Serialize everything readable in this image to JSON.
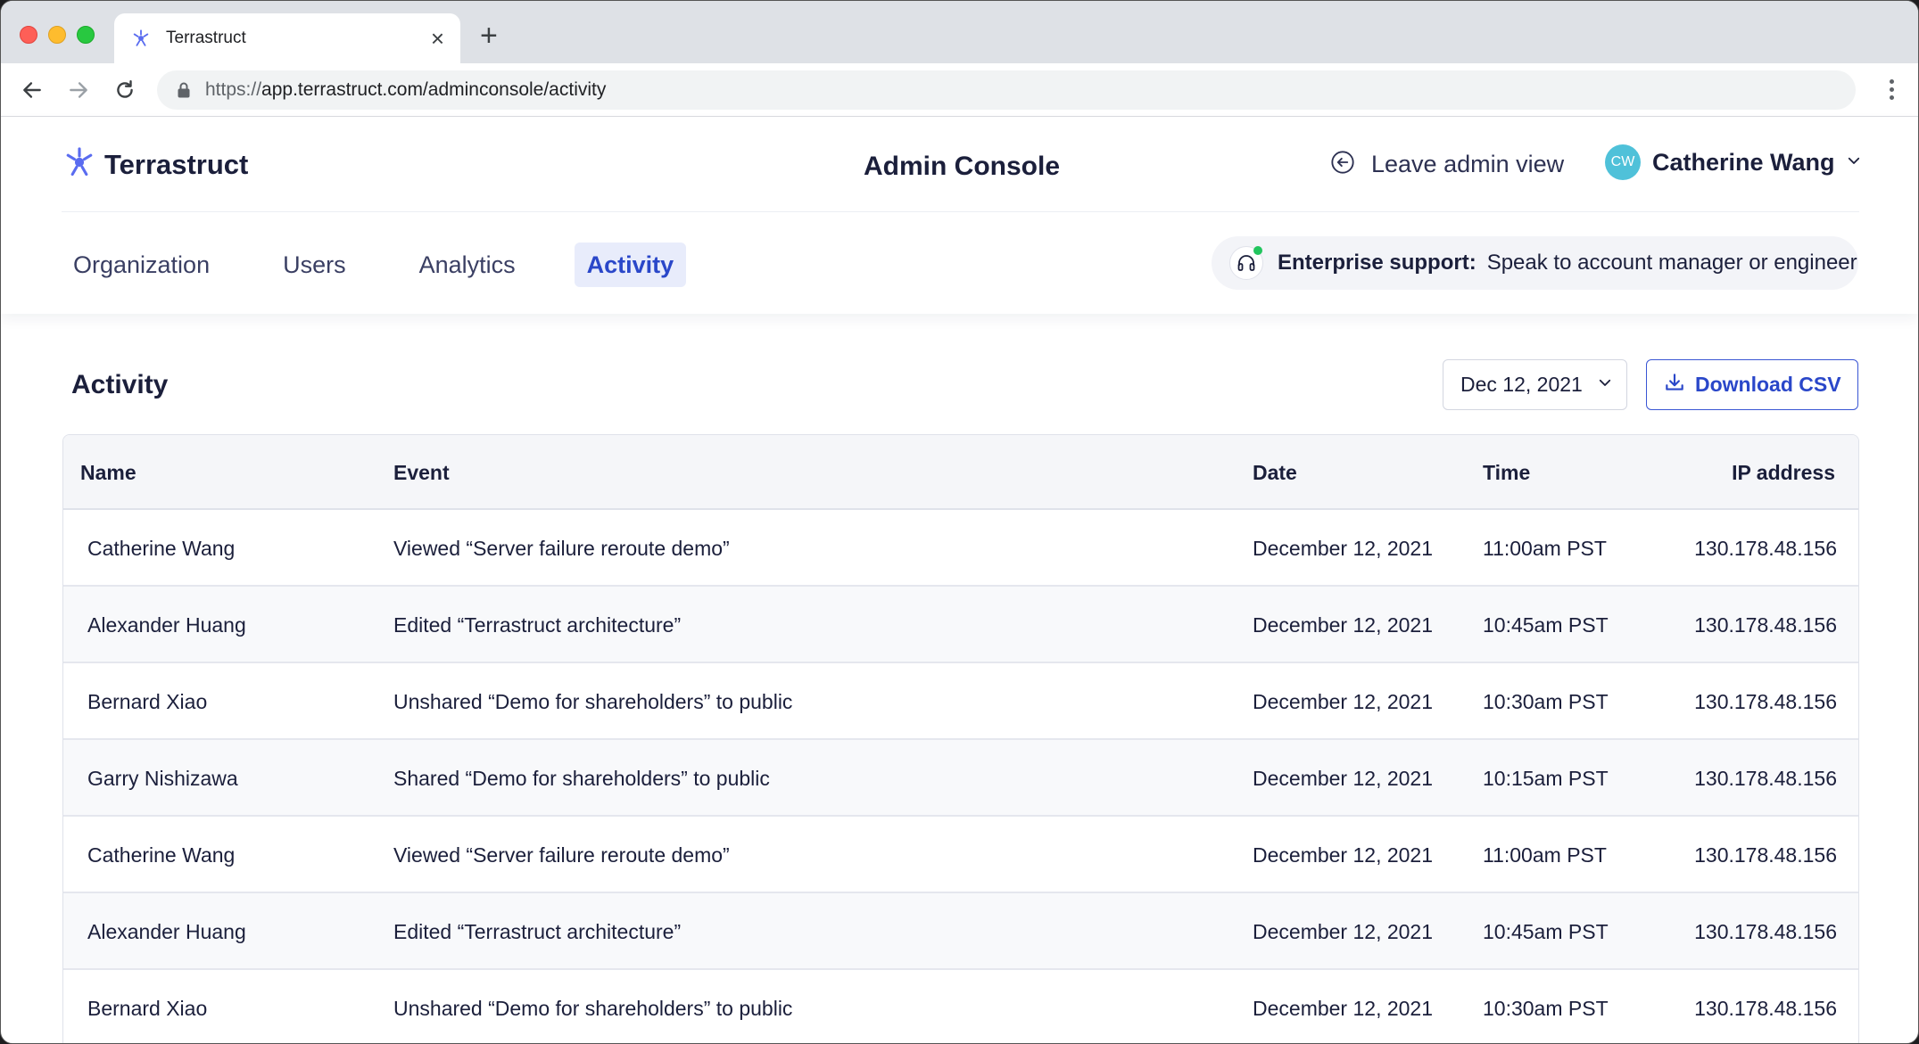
{
  "browser": {
    "tab_title": "Terrastruct",
    "url_scheme": "https://",
    "url_rest": "app.terrastruct.com/adminconsole/activity"
  },
  "header": {
    "brand": "Terrastruct",
    "title": "Admin Console",
    "leave_label": "Leave admin view",
    "user": {
      "initials": "CW",
      "name": "Catherine Wang"
    }
  },
  "nav": {
    "tabs": [
      {
        "label": "Organization",
        "active": false
      },
      {
        "label": "Users",
        "active": false
      },
      {
        "label": "Analytics",
        "active": false
      },
      {
        "label": "Activity",
        "active": true
      }
    ]
  },
  "support": {
    "strong": "Enterprise support:",
    "text": "Speak to account manager or engineer"
  },
  "activity": {
    "title": "Activity",
    "date_value": "Dec 12, 2021",
    "download_label": "Download CSV",
    "columns": [
      "Name",
      "Event",
      "Date",
      "Time",
      "IP address"
    ],
    "rows": [
      [
        "Catherine Wang",
        "Viewed “Server failure reroute demo”",
        "December 12, 2021",
        "11:00am PST",
        "130.178.48.156"
      ],
      [
        "Alexander Huang",
        "Edited “Terrastruct architecture”",
        "December 12, 2021",
        "10:45am PST",
        "130.178.48.156"
      ],
      [
        "Bernard Xiao",
        "Unshared “Demo for shareholders” to public",
        "December 12, 2021",
        "10:30am PST",
        "130.178.48.156"
      ],
      [
        "Garry Nishizawa",
        "Shared “Demo for shareholders” to public",
        "December 12, 2021",
        "10:15am PST",
        "130.178.48.156"
      ],
      [
        "Catherine Wang",
        "Viewed “Server failure reroute demo”",
        "December 12, 2021",
        "11:00am PST",
        "130.178.48.156"
      ],
      [
        "Alexander Huang",
        "Edited “Terrastruct architecture”",
        "December 12, 2021",
        "10:45am PST",
        "130.178.48.156"
      ],
      [
        "Bernard Xiao",
        "Unshared “Demo for shareholders” to public",
        "December 12, 2021",
        "10:30am PST",
        "130.178.48.156"
      ]
    ]
  },
  "colors": {
    "accent": "#2a47c9",
    "active_tab_bg": "#e8ecfb",
    "avatar": "#4fc1d9",
    "status_online": "#22c55e"
  },
  "icons": {
    "brand": "terrastruct-logo-icon",
    "leave": "arrow-circle-left-icon",
    "user_menu": "chevron-down-icon",
    "support": "headset-icon",
    "date": "chevron-down-icon",
    "download": "download-icon"
  }
}
